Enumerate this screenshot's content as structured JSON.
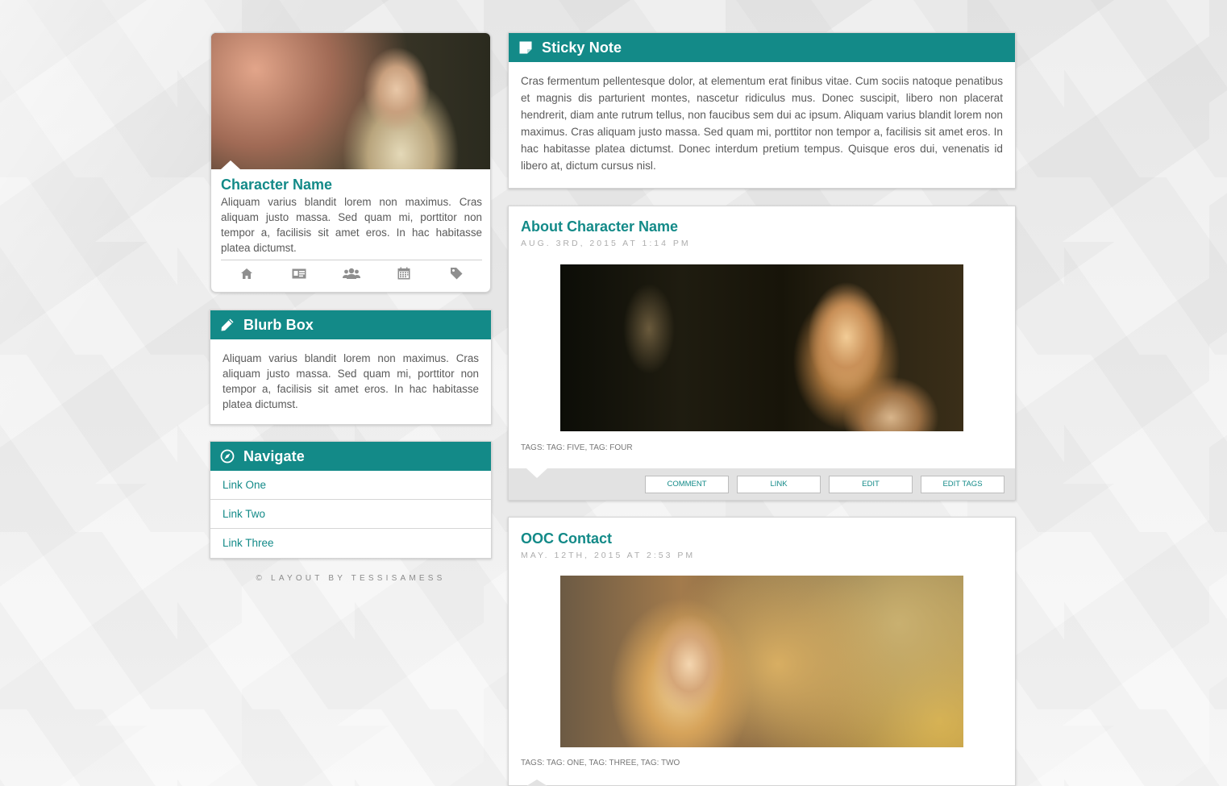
{
  "profile": {
    "name": "Character Name",
    "bio": "Aliquam varius blandit lorem non maximus. Cras aliquam justo massa. Sed quam mi, porttitor non tempor a, facilisis sit amet eros. In hac habitasse platea dictumst.",
    "icons": [
      "home-icon",
      "id-card-icon",
      "users-icon",
      "calendar-icon",
      "tag-icon"
    ]
  },
  "blurb": {
    "title": "Blurb Box",
    "icon": "pencil-icon",
    "text": "Aliquam varius blandit lorem non maximus. Cras aliquam justo massa. Sed quam mi, porttitor non tempor a, facilisis sit amet eros. In hac habitasse platea dictumst."
  },
  "navigate": {
    "title": "Navigate",
    "icon": "compass-icon",
    "links": [
      "Link One",
      "Link Two",
      "Link Three"
    ]
  },
  "credit": "© Layout by tessisamess",
  "sticky": {
    "title": "Sticky Note",
    "icon": "note-icon",
    "text": "Cras fermentum pellentesque dolor, at elementum erat finibus vitae. Cum sociis natoque penatibus et magnis dis parturient montes, nascetur ridiculus mus. Donec suscipit, libero non placerat hendrerit, diam ante rutrum tellus, non faucibus sem dui ac ipsum. Aliquam varius blandit lorem non maximus. Cras aliquam justo massa. Sed quam mi, porttitor non tempor a, facilisis sit amet eros. In hac habitasse platea dictumst. Donec interdum pretium tempus. Quisque eros dui, venenatis id libero at, dictum cursus nisl."
  },
  "posts": [
    {
      "title": "About Character Name",
      "date": "Aug. 3rd, 2015 at 1:14 PM",
      "tags_label": "Tags:",
      "tags": [
        "Tag: Five",
        "Tag: Four"
      ],
      "actions": [
        "Comment",
        "Link",
        "Edit",
        "Edit Tags"
      ]
    },
    {
      "title": "OOC Contact",
      "date": "May. 12th, 2015 at 2:53 PM",
      "tags_label": "Tags:",
      "tags": [
        "Tag: One",
        "Tag: Three",
        "Tag: Two"
      ]
    }
  ],
  "colors": {
    "accent": "#138a88",
    "footer_bar": "#e2e2e2",
    "text": "#5a5a5a"
  }
}
